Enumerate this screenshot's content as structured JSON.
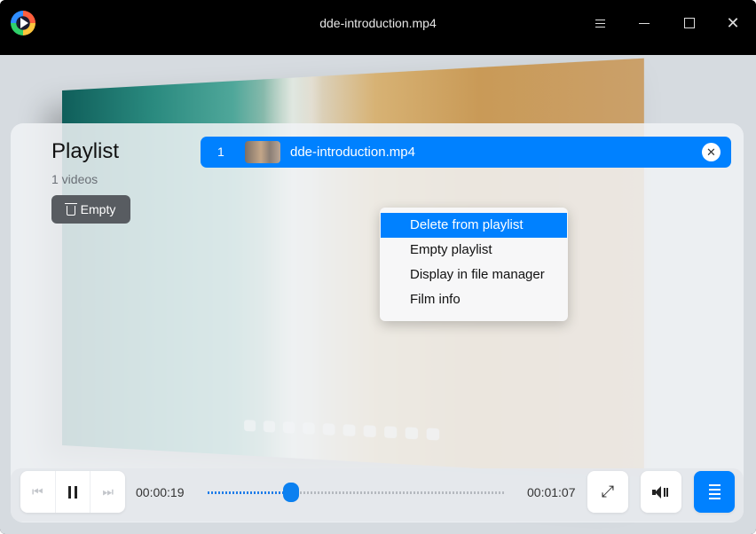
{
  "window": {
    "title": "dde-introduction.mp4",
    "icons": {
      "app": "deepin-movie-logo",
      "menu": "hamburger-menu-icon",
      "minimize": "minimize-icon",
      "maximize": "maximize-icon",
      "close": "close-icon"
    }
  },
  "playlist": {
    "heading": "Playlist",
    "count": "1 videos",
    "empty_label": "Empty",
    "items": [
      {
        "index": "1",
        "name": "dde-introduction.mp4"
      }
    ],
    "accent": "#0081ff"
  },
  "context_menu": {
    "items": [
      {
        "label": "Delete from playlist"
      },
      {
        "label": "Empty playlist"
      },
      {
        "label": "Display in file manager"
      },
      {
        "label": "Film info"
      }
    ]
  },
  "controls": {
    "current_time": "00:00:19",
    "total_time": "00:01:07",
    "progress_fraction": 0.28
  }
}
